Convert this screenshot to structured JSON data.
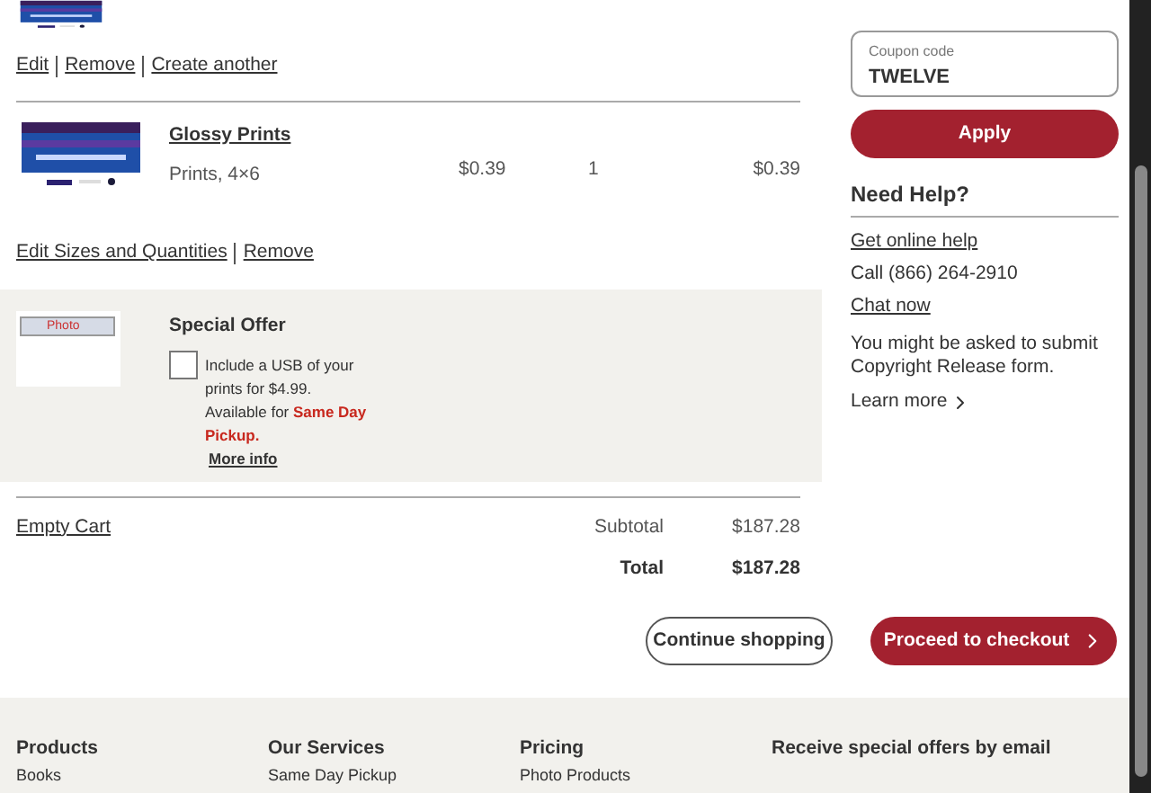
{
  "first_item": {
    "kind": "picture",
    "links": [
      "Edit",
      "Remove",
      "Create another"
    ]
  },
  "cart_item": {
    "kind": "picture",
    "name": "Glossy Prints",
    "description": "Prints, 4×6",
    "price": "$0.39",
    "quantity": "1",
    "total": "$0.39",
    "links": [
      "Edit Sizes and Quantities",
      "Remove"
    ]
  },
  "special_offer": {
    "title": "Special Offer",
    "checked": false,
    "text": "Include a USB of your prints for $4.99. Available for",
    "highlight": "Same Day Pickup.",
    "more_link": "More info",
    "image_label": "Photo"
  },
  "summary": {
    "empty_cart": "Empty Cart",
    "subtotal_label": "Subtotal",
    "subtotal": "$187.28",
    "total_label": "Total",
    "total": "$187.28"
  },
  "coupon": {
    "label": "Coupon code",
    "value": "TWELVE",
    "button": "Apply"
  },
  "help": {
    "title": "Need Help?",
    "online_help": "Get online help",
    "call": "Call (866) 264-2910",
    "chat": "Chat now",
    "note": "You might be asked to submit Copyright Release form.",
    "learn_more": "Learn more"
  },
  "actions": {
    "continue": "Continue shopping",
    "checkout": "Proceed to checkout"
  },
  "footer": {
    "columns": [
      {
        "title": "Products",
        "link": "Books"
      },
      {
        "title": "Our Services",
        "link": "Same Day Pickup"
      },
      {
        "title": "Pricing",
        "link": "Photo Products"
      },
      {
        "title": "Receive special offers by email"
      }
    ]
  }
}
